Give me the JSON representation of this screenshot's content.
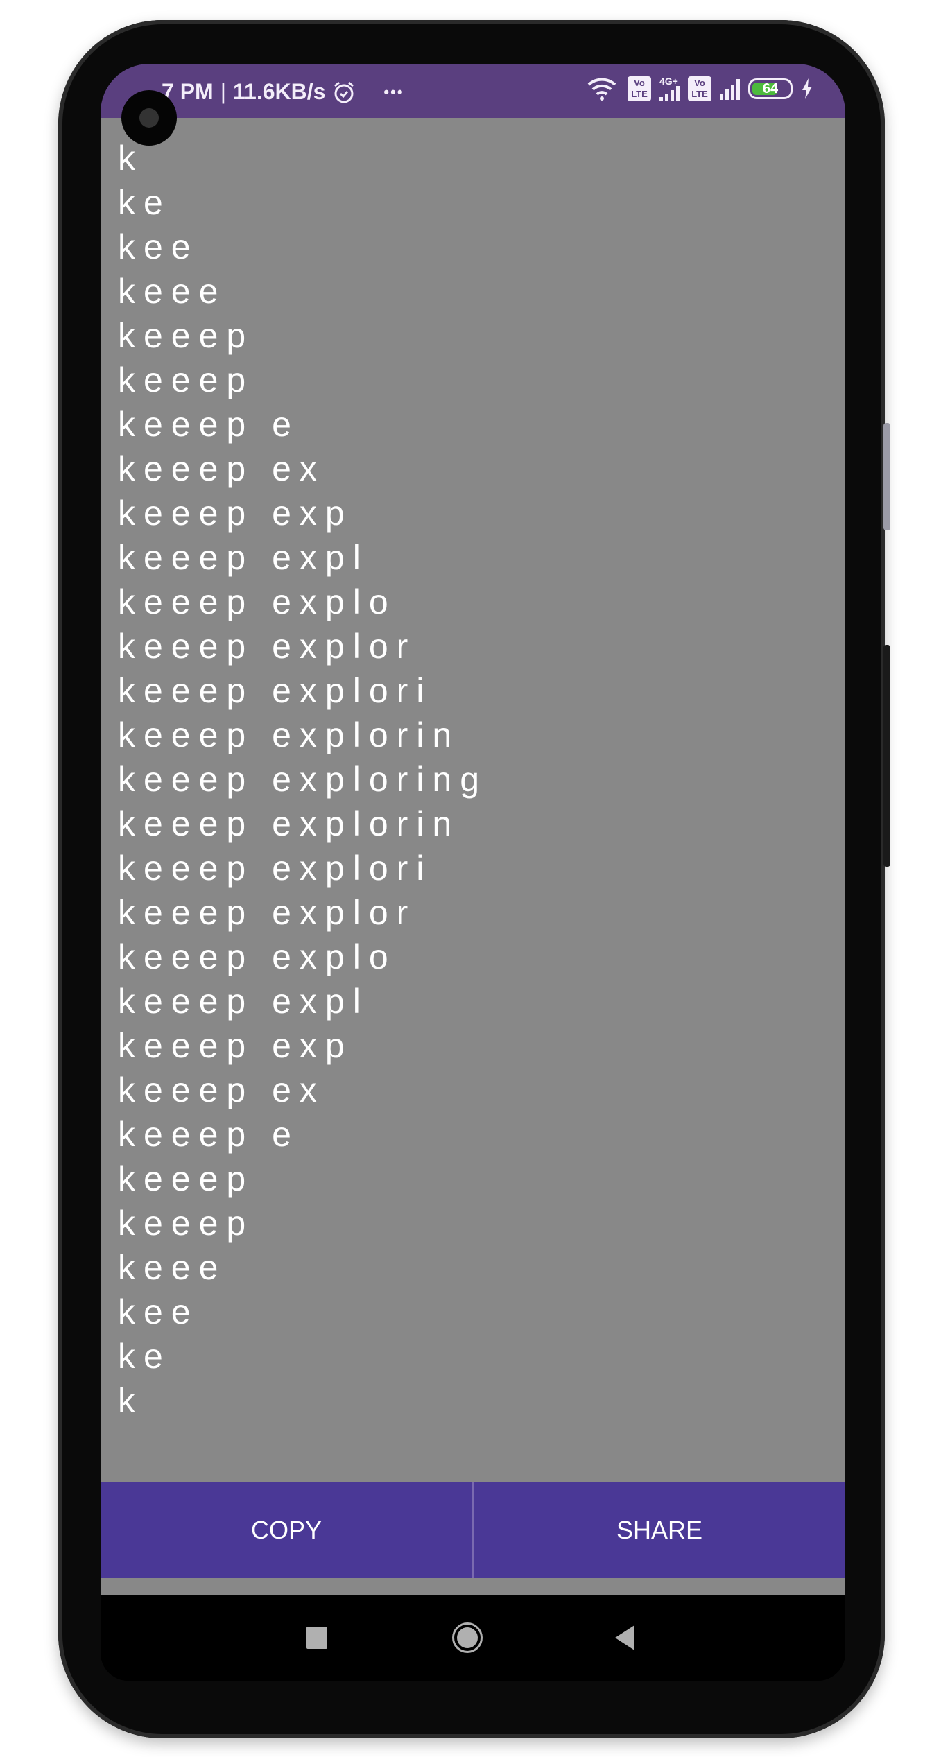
{
  "status_bar": {
    "time": "7 PM",
    "network_speed": "11.6KB/s",
    "alarm_icon": "alarm-icon",
    "more": "•••",
    "sim1_label": "Vo LTE",
    "sim1_type": "4G+",
    "sim2_label": "Vo LTE",
    "battery": "64",
    "colors": {
      "bar": "#5a3f7f",
      "battery_fill": "#4cba3c"
    }
  },
  "content": {
    "background": "#888888",
    "lines": [
      "k",
      "ke",
      "kee",
      "keee",
      "keeep",
      "keeep",
      "keeep e",
      "keeep ex",
      "keeep exp",
      "keeep expl",
      "keeep explo",
      "keeep explor",
      "keeep explori",
      "keeep explorin",
      "keeep exploring",
      "keeep explorin",
      "keeep explori",
      "keeep explor",
      "keeep explo",
      "keeep expl",
      "keeep exp",
      "keeep ex",
      "keeep e",
      "keeep",
      "keeep",
      "keee",
      "kee",
      "ke",
      "k"
    ]
  },
  "actions": {
    "copy": "COPY",
    "share": "SHARE",
    "color": "#4a3896"
  },
  "nav": {
    "recents": "square-icon",
    "home": "circle-icon",
    "back": "triangle-back-icon"
  }
}
